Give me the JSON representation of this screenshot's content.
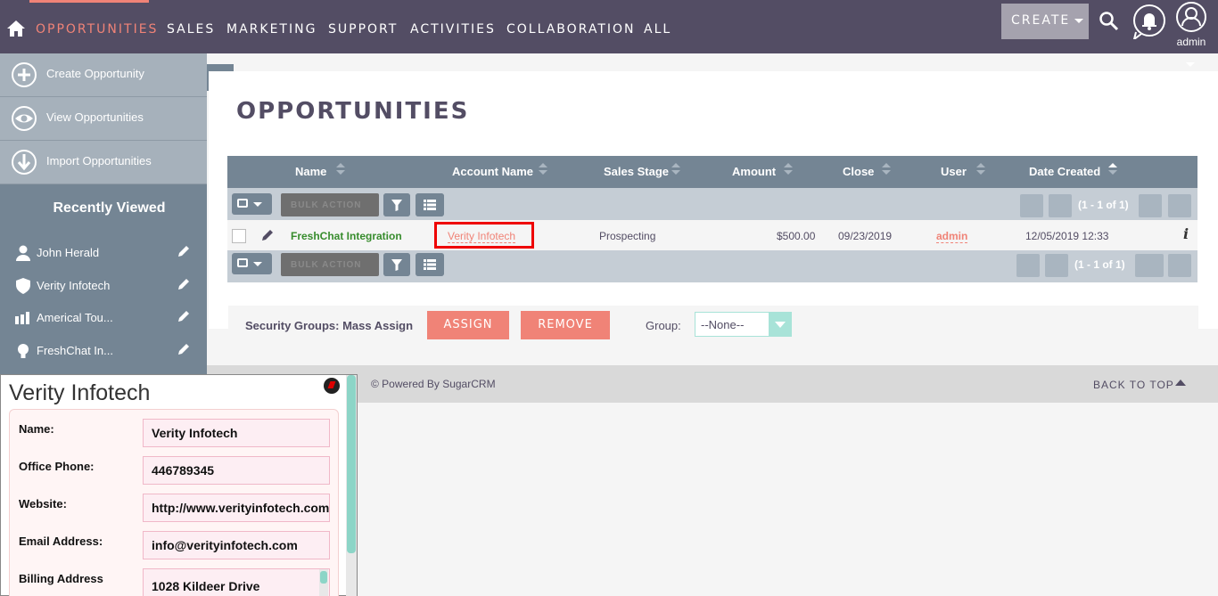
{
  "nav": {
    "items": [
      "OPPORTUNITIES",
      "SALES",
      "MARKETING",
      "SUPPORT",
      "ACTIVITIES",
      "COLLABORATION",
      "ALL"
    ],
    "create_label": "CREATE",
    "user_label": "admin"
  },
  "sidebar": {
    "actions": [
      "Create Opportunity",
      "View Opportunities",
      "Import Opportunities"
    ],
    "recent_title": "Recently Viewed",
    "recent_items": [
      {
        "label": "John Herald",
        "icon": "contact-icon"
      },
      {
        "label": "Verity Infotech",
        "icon": "account-shield-icon"
      },
      {
        "label": "Americal Tou...",
        "icon": "chart-icon"
      },
      {
        "label": "FreshChat In...",
        "icon": "lightbulb-icon"
      }
    ],
    "collapse_glyph": "◁"
  },
  "page": {
    "title": "OPPORTUNITIES"
  },
  "table": {
    "columns": [
      "Name",
      "Account Name",
      "Sales Stage",
      "Amount",
      "Close",
      "User",
      "Date Created"
    ],
    "sorted_column": "Date Created",
    "bulk_action": "BULK ACTION",
    "pagination": "(1 - 1 of 1)",
    "rows": [
      {
        "name": "FreshChat Integration",
        "account": "Verity Infotech",
        "stage": "Prospecting",
        "amount": "$500.00",
        "close": "09/23/2019",
        "user": "admin",
        "created": "12/05/2019 12:33",
        "info": "i"
      }
    ]
  },
  "security": {
    "label": "Security Groups: Mass Assign",
    "assign": "ASSIGN",
    "remove": "REMOVE",
    "group_label": "Group:",
    "group_value": "--None--"
  },
  "footer": {
    "powered": "© Powered By SugarCRM",
    "backtop": "BACK TO TOP"
  },
  "popup": {
    "title": "Verity Infotech",
    "fields": [
      {
        "label": "Name:",
        "value": "Verity Infotech"
      },
      {
        "label": "Office Phone:",
        "value": "446789345"
      },
      {
        "label": "Website:",
        "value": "http://www.verityinfotech.com"
      },
      {
        "label": "Email Address:",
        "value": "info@verityinfotech.com"
      },
      {
        "label": "Billing Address",
        "value": "1028  Kildeer Drive"
      }
    ]
  },
  "colors": {
    "nav_bg": "#534d64",
    "accent": "#f08377",
    "sidebar_bg": "#748594",
    "highlight_box": "#ee0000"
  }
}
